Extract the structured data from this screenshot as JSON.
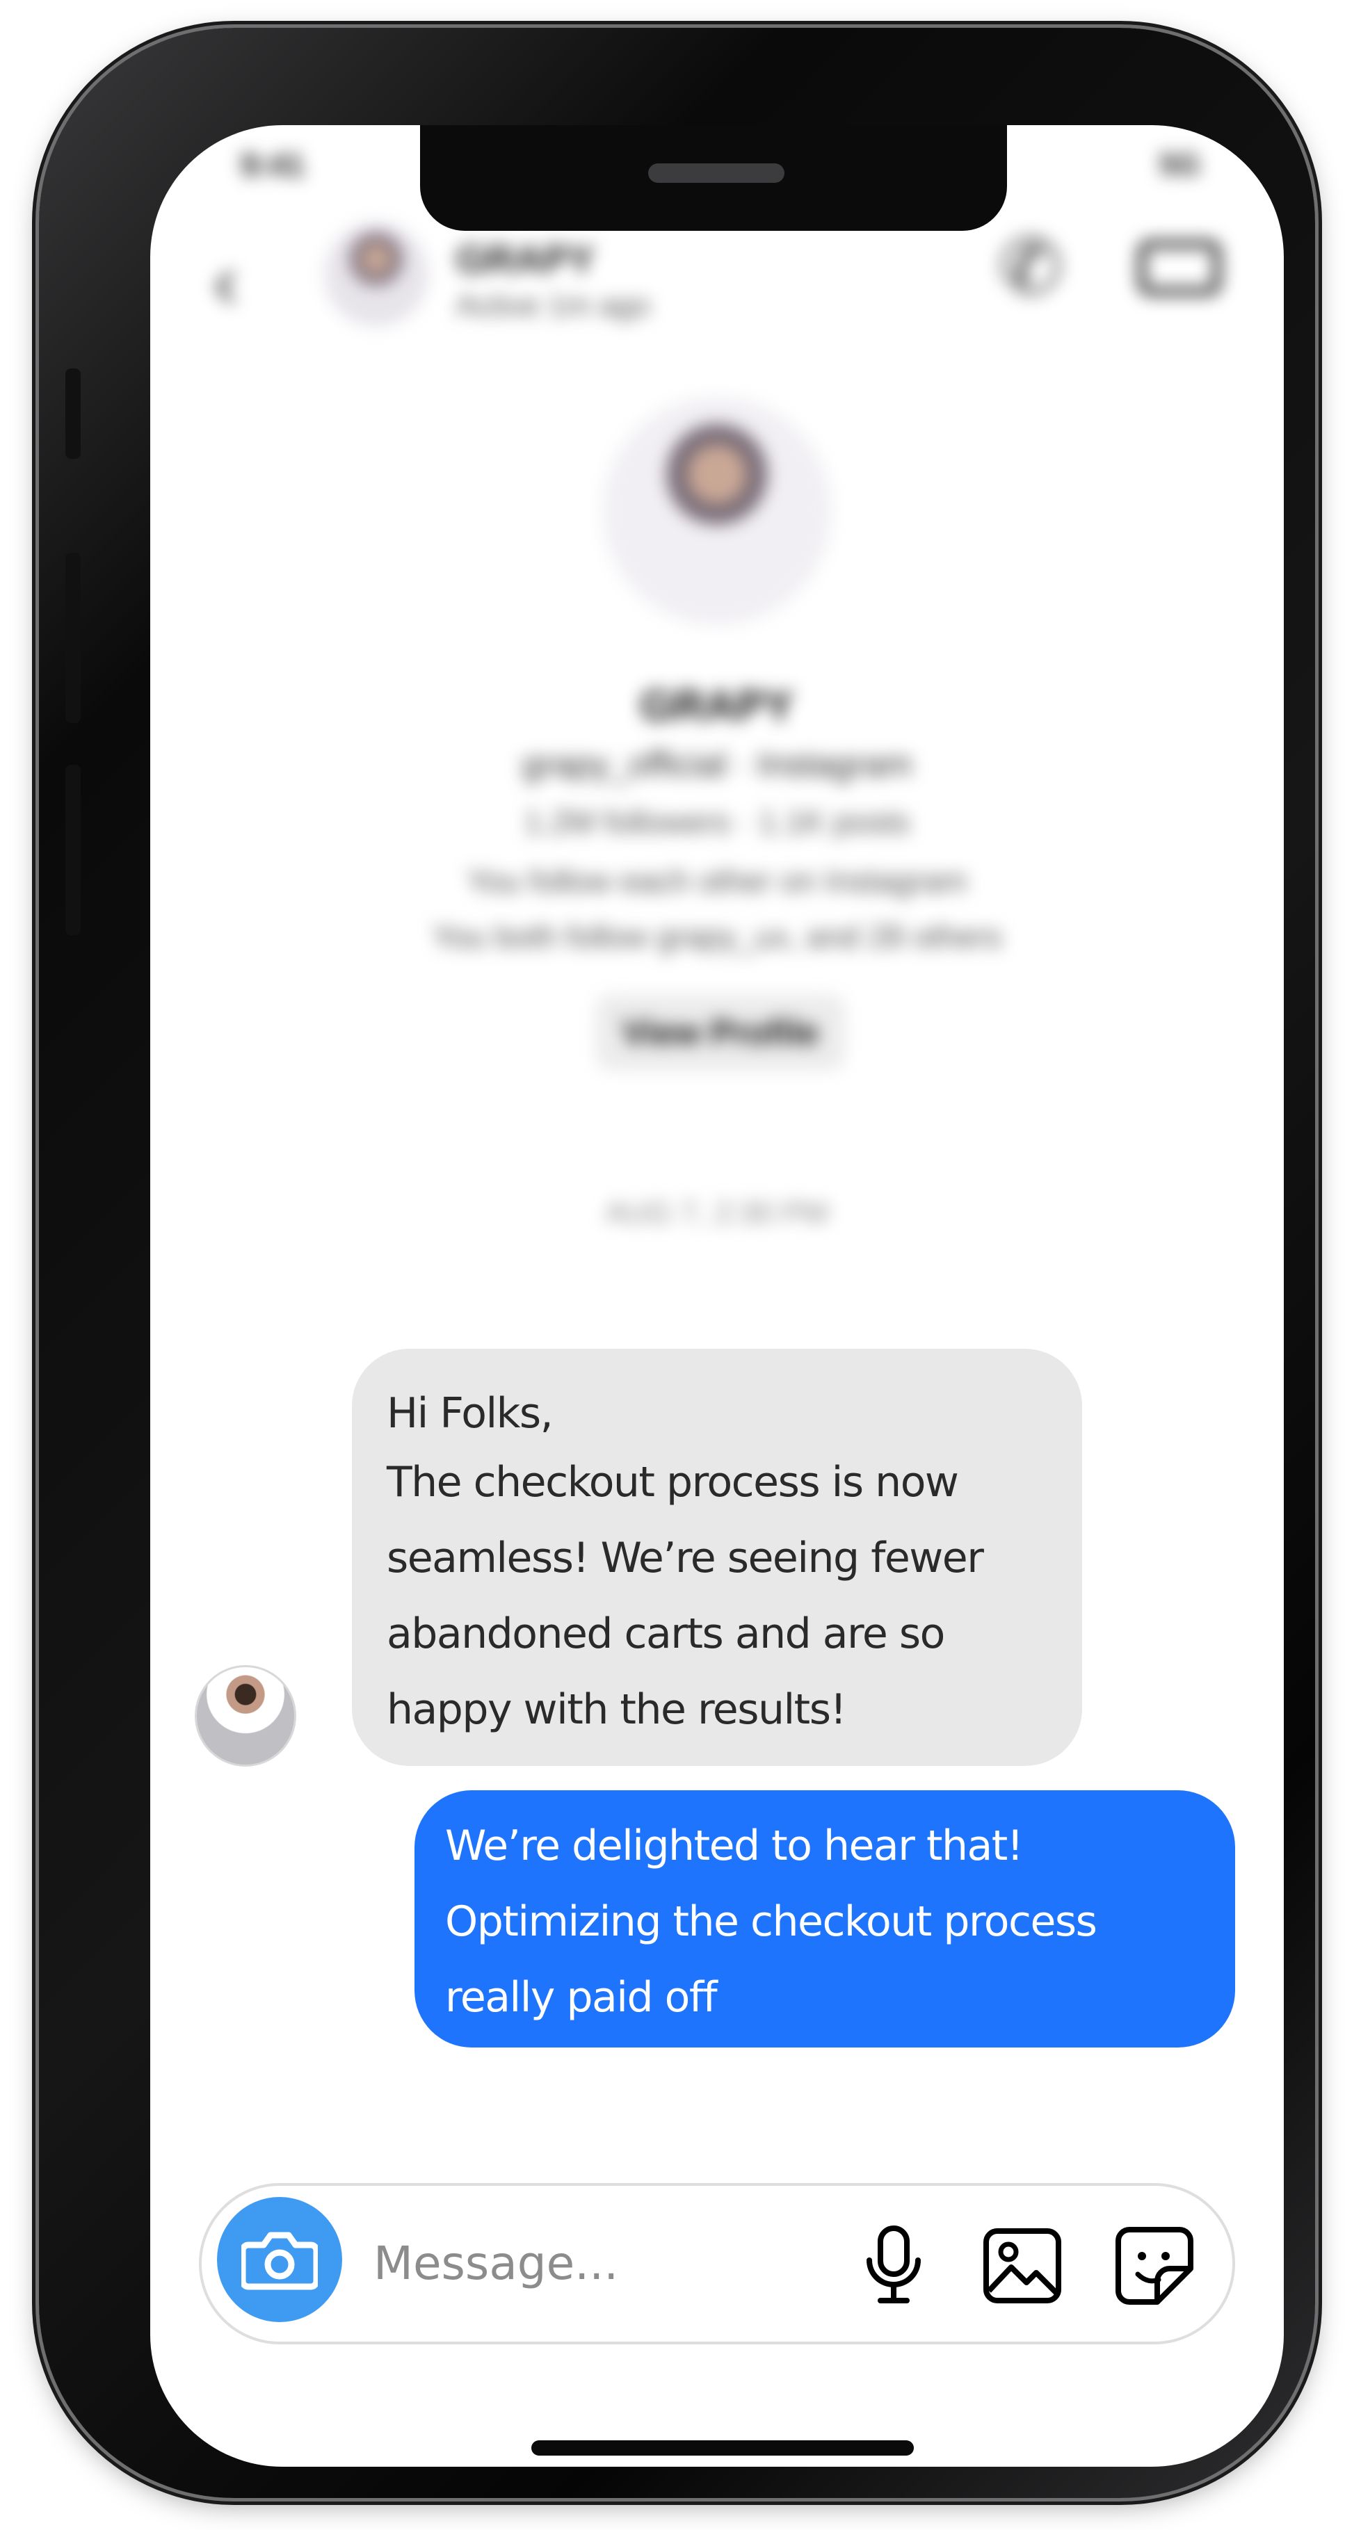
{
  "status_bar": {
    "time": "9:41",
    "indicators": "5G"
  },
  "header": {
    "contact_name": "GRAPY",
    "contact_status": "Active 1m ago",
    "icons": [
      "back-arrow-icon",
      "phone-icon",
      "video-icon"
    ]
  },
  "profile": {
    "name": "GRAPY",
    "handle": "grapy_official · Instagram",
    "stats": "1.2M followers · 1.1K posts",
    "follow_note": "You follow each other on Instagram",
    "mutual_note": "You both follow grapy_ux, and 28 others",
    "view_profile_label": "View Profile"
  },
  "thread": {
    "timestamp": "AUG 7, 2:30 PM",
    "incoming": {
      "lines": [
        "Hi Folks,",
        "The checkout process is now",
        "seamless! We’re seeing fewer",
        "abandoned carts and are so",
        "happy with the results!"
      ]
    },
    "outgoing": {
      "lines": [
        "We’re delighted to hear that!",
        "Optimizing the checkout process",
        "really paid off"
      ]
    }
  },
  "composer": {
    "placeholder": "Message...",
    "icons": [
      "camera-icon",
      "microphone-icon",
      "gallery-icon",
      "sticker-icon"
    ]
  },
  "colors": {
    "outgoing_bubble": "#1e74fd",
    "incoming_bubble": "#e8e8e8",
    "camera_button": "#3f9bf2"
  }
}
